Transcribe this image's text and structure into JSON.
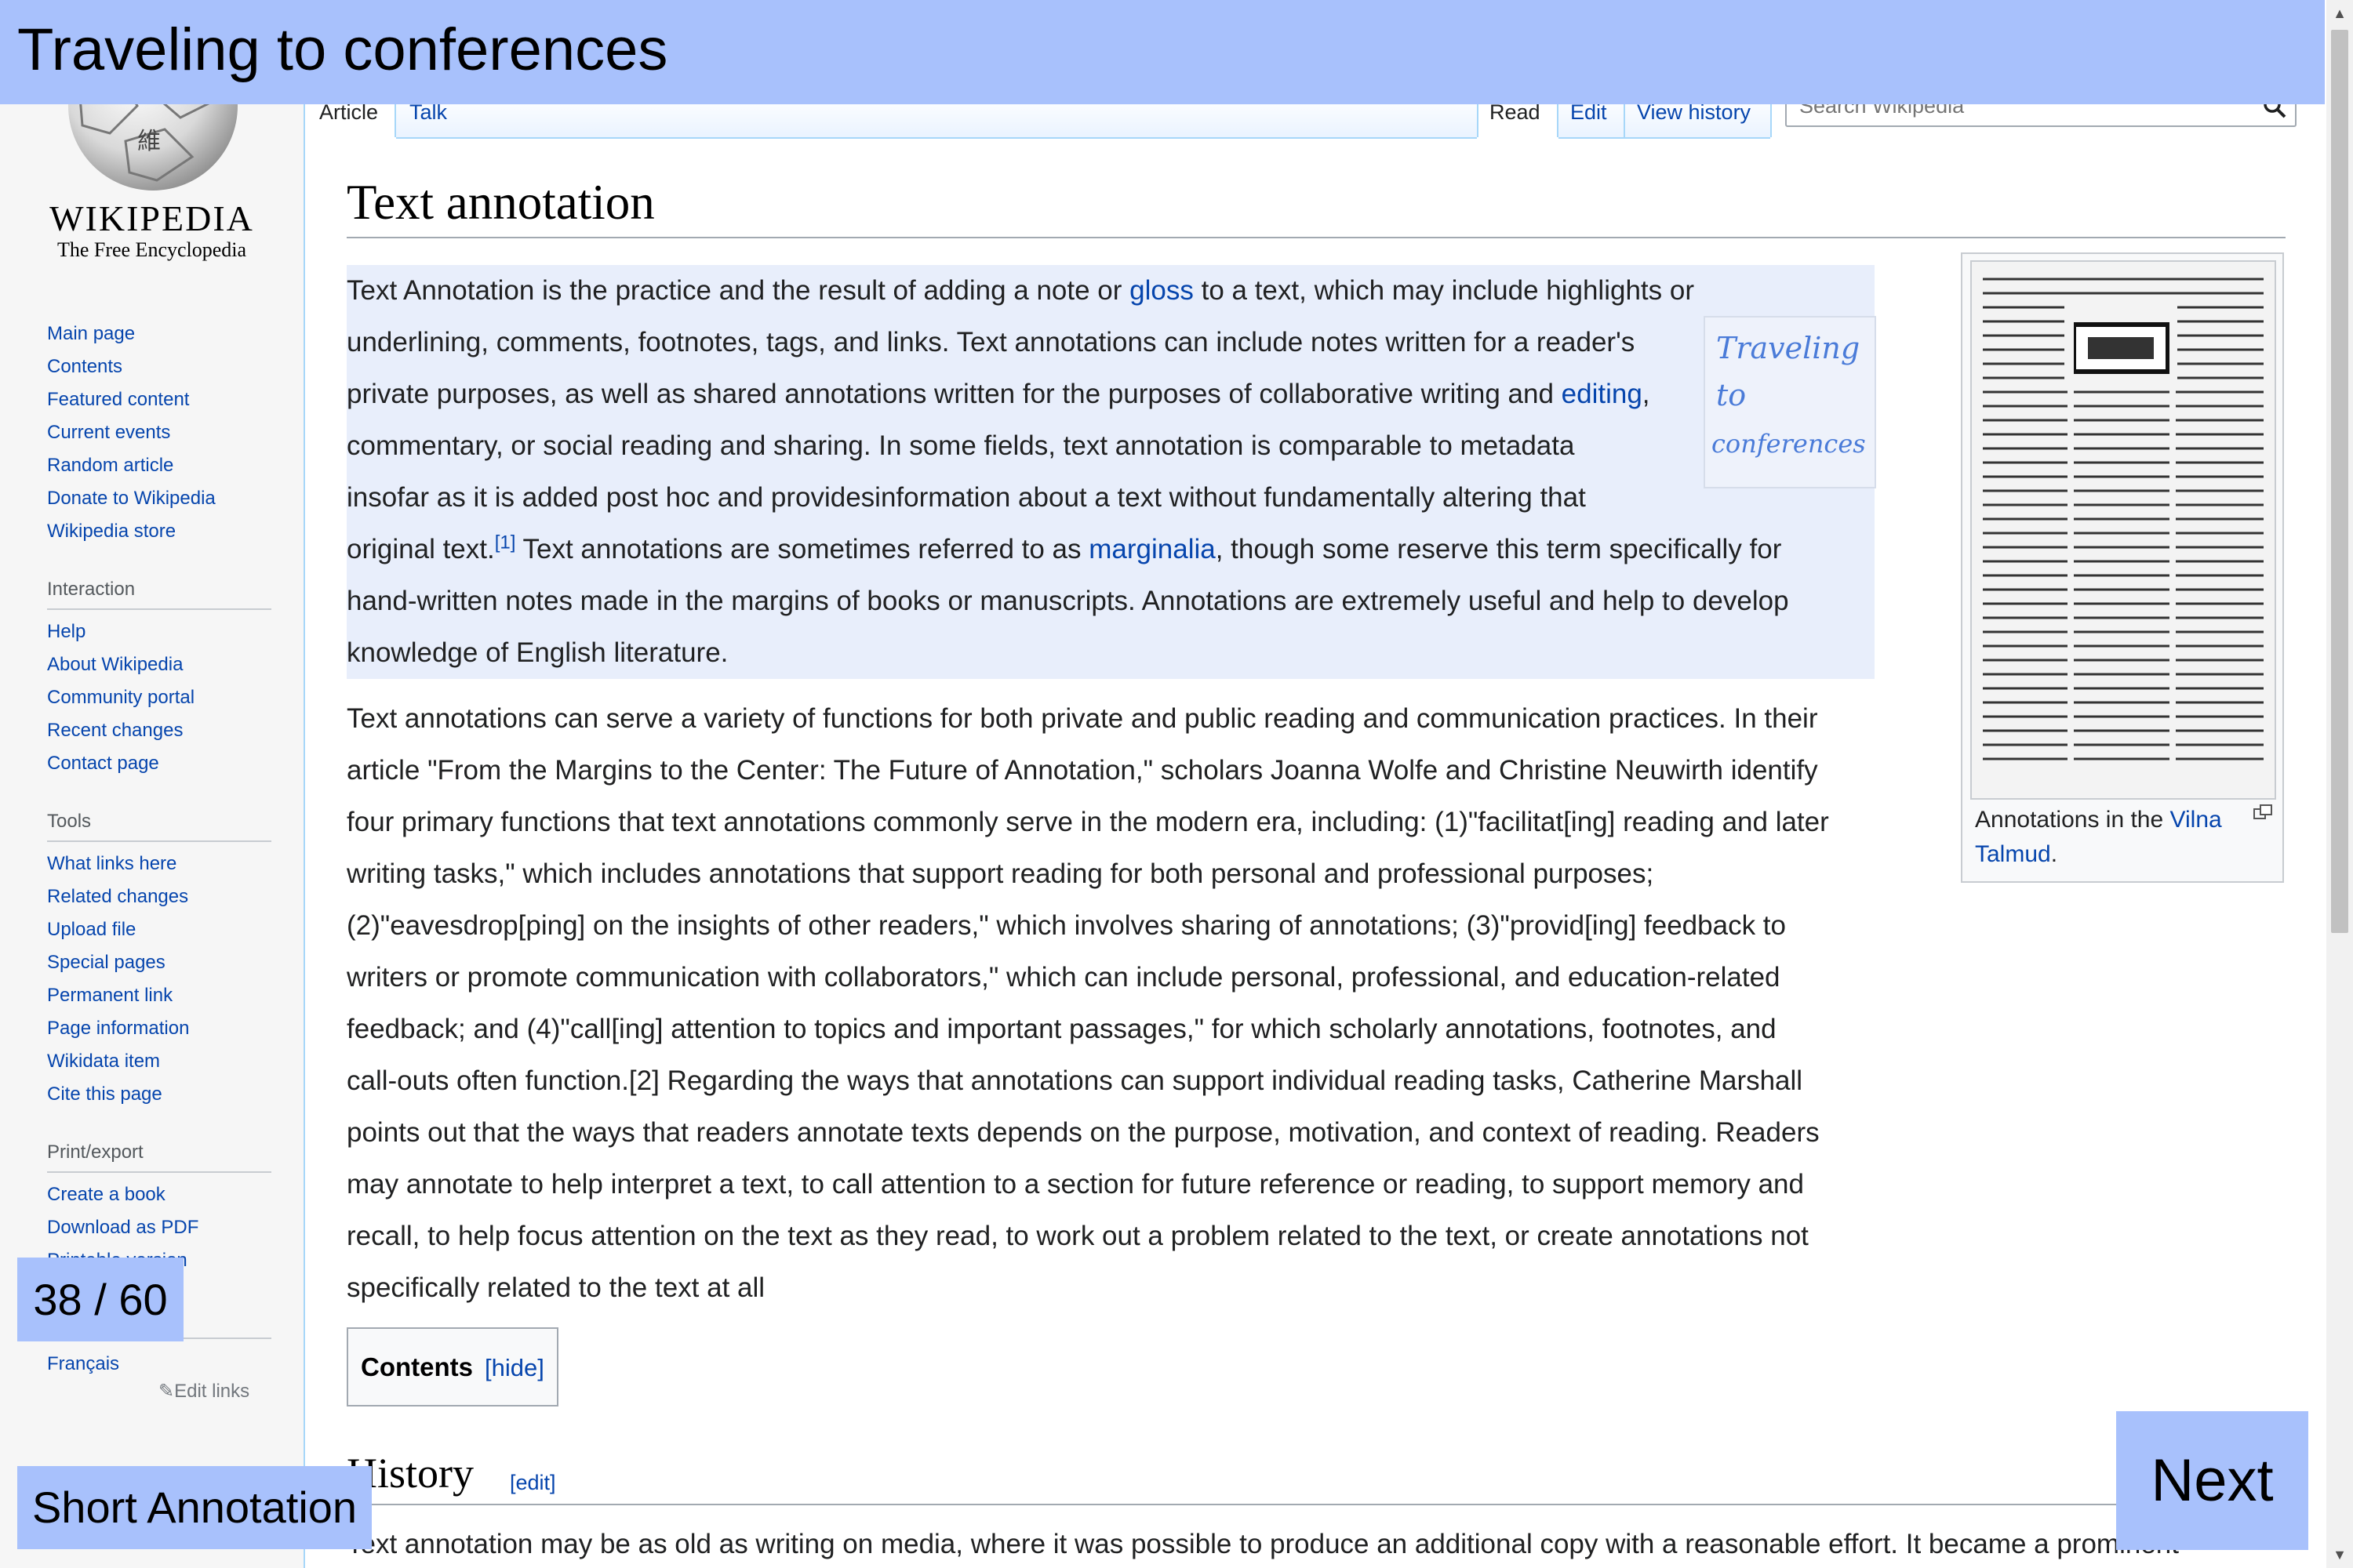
{
  "overlay": {
    "title": "Traveling to conferences",
    "page_counter": "38 / 60",
    "mode_button": "Short Annotation",
    "next_button": "Next"
  },
  "logo": {
    "wordmark": "WIKIPEDIA",
    "tagline": "The Free Encyclopedia"
  },
  "sidebar": {
    "main_links": [
      "Main page",
      "Contents",
      "Featured content",
      "Current events",
      "Random article",
      "Donate to Wikipedia",
      "Wikipedia store"
    ],
    "interaction": {
      "heading": "Interaction",
      "links": [
        "Help",
        "About Wikipedia",
        "Community portal",
        "Recent changes",
        "Contact page"
      ]
    },
    "tools": {
      "heading": "Tools",
      "links": [
        "What links here",
        "Related changes",
        "Upload file",
        "Special pages",
        "Permanent link",
        "Page information",
        "Wikidata item",
        "Cite this page"
      ]
    },
    "print_export": {
      "heading": "Print/export",
      "links": [
        "Create a book",
        "Download as PDF",
        "Printable version"
      ]
    },
    "languages": {
      "links": [
        "Français"
      ],
      "edit_links": "Edit links"
    }
  },
  "tabs": {
    "article": "Article",
    "talk": "Talk",
    "read": "Read",
    "edit": "Edit",
    "view_history": "View history"
  },
  "search": {
    "placeholder": "Search Wikipedia"
  },
  "article": {
    "title": "Text annotation",
    "para1": {
      "l1a": "Text Annotation is the practice and the result of adding a note or ",
      "l1link": "gloss",
      "l1b": " to a text, which may include highlights or",
      "l2": "underlining, comments, footnotes, tags, and links. Text annotations can include notes written for a reader's",
      "l3a": "private purposes, as well as shared annotations written for the purposes of collaborative writing and ",
      "l3link": "editing",
      "l3b": ",",
      "l4": "commentary, or social reading and sharing. In some fields, text annotation is comparable to metadata",
      "l5": "insofar as it is added post hoc and providesinformation about a text without fundamentally altering that",
      "l6a": "original text.",
      "l6ref": "[1]",
      "l6b": " Text annotations are sometimes referred to as ",
      "l6link": "marginalia",
      "l6c": ", though some reserve this term specifically for",
      "l7": "hand-written notes made in the margins of books or manuscripts. Annotations are extremely useful and help to develop",
      "l8": "knowledge of English literature."
    },
    "para2": [
      "Text annotations can serve a variety of functions for both private and public reading and communication practices. In their",
      "article \"From the Margins to the Center: The Future of Annotation,\" scholars Joanna Wolfe and Christine Neuwirth identify",
      "four primary functions that text annotations commonly serve in the modern era, including: (1)\"facilitat[ing] reading and later",
      "writing tasks,\" which includes annotations that support reading for both personal and professional purposes;",
      "(2)\"eavesdrop[ping] on the insights of other readers,\" which involves sharing of annotations; (3)\"provid[ing] feedback to",
      "writers or promote communication with collaborators,\" which can include personal, professional, and education-related",
      "feedback; and (4)\"call[ing] attention to topics and important passages,\" for which scholarly annotations, footnotes, and",
      "call-outs often function.[2] Regarding the ways that annotations can support individual reading tasks, Catherine Marshall",
      "points out that the ways that readers annotate texts depends on the purpose, motivation, and context of reading. Readers",
      "may annotate to help interpret a text, to call attention to a section for future reference or reading, to support memory and",
      "recall, to help focus attention on the text as they read, to work out a problem related to the text, or create annotations not",
      "specifically related to the text at all"
    ],
    "handwritten_note": [
      "Traveling",
      "to",
      "conferences"
    ],
    "thumb": {
      "caption_prefix": "Annotations in the ",
      "caption_link": "Vilna Talmud",
      "caption_suffix": "."
    },
    "toc": {
      "title": "Contents",
      "hide": "[hide]"
    },
    "history": {
      "heading": "History",
      "edit": "[edit]",
      "text": "Text annotation may be as old as writing on media, where it was possible to produce an additional copy with a reasonable effort. It became a prominent"
    }
  },
  "colors": {
    "overlay": "#a8c1fc",
    "highlight": "#e8eefb",
    "link": "#0645ad"
  }
}
